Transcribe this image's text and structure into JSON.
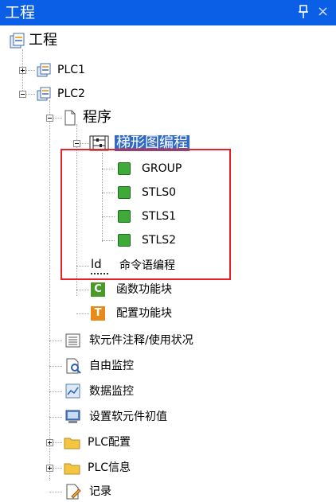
{
  "panel": {
    "title": "工程",
    "pin_icon": "pin-icon",
    "close_symbol": "×"
  },
  "tree": {
    "root": {
      "label": "工程",
      "icon": "project-icon"
    },
    "plc1": {
      "label": "PLC1",
      "expanded": false
    },
    "plc2": {
      "label": "PLC2",
      "expanded": true
    },
    "program": {
      "label": "程序",
      "expanded": true
    },
    "ladder": {
      "label": "梯形图编程",
      "selected": true,
      "expanded": true
    },
    "ladder_items": [
      "GROUP",
      "STLS0",
      "STLS1",
      "STLS2"
    ],
    "instruction_list": {
      "label": "命令语编程",
      "icon_text": "ld"
    },
    "function_block": {
      "label": "函数功能块",
      "icon_text": "C"
    },
    "config_block": {
      "label": "配置功能块",
      "icon_text": "T"
    },
    "device_comment": {
      "label": "软元件注释/使用状况"
    },
    "free_monitor": {
      "label": "自由监控"
    },
    "data_monitor": {
      "label": "数据监控"
    },
    "device_init": {
      "label": "设置软元件初值"
    },
    "plc_config": {
      "label": "PLC配置",
      "expanded": false
    },
    "plc_info": {
      "label": "PLC信息",
      "expanded": false
    },
    "log": {
      "label": "记录"
    }
  },
  "colors": {
    "title_bg": "#0a5fe6",
    "selection_bg": "#316ac5",
    "highlight_box": "#e8202a",
    "folder": "#f4c542"
  }
}
